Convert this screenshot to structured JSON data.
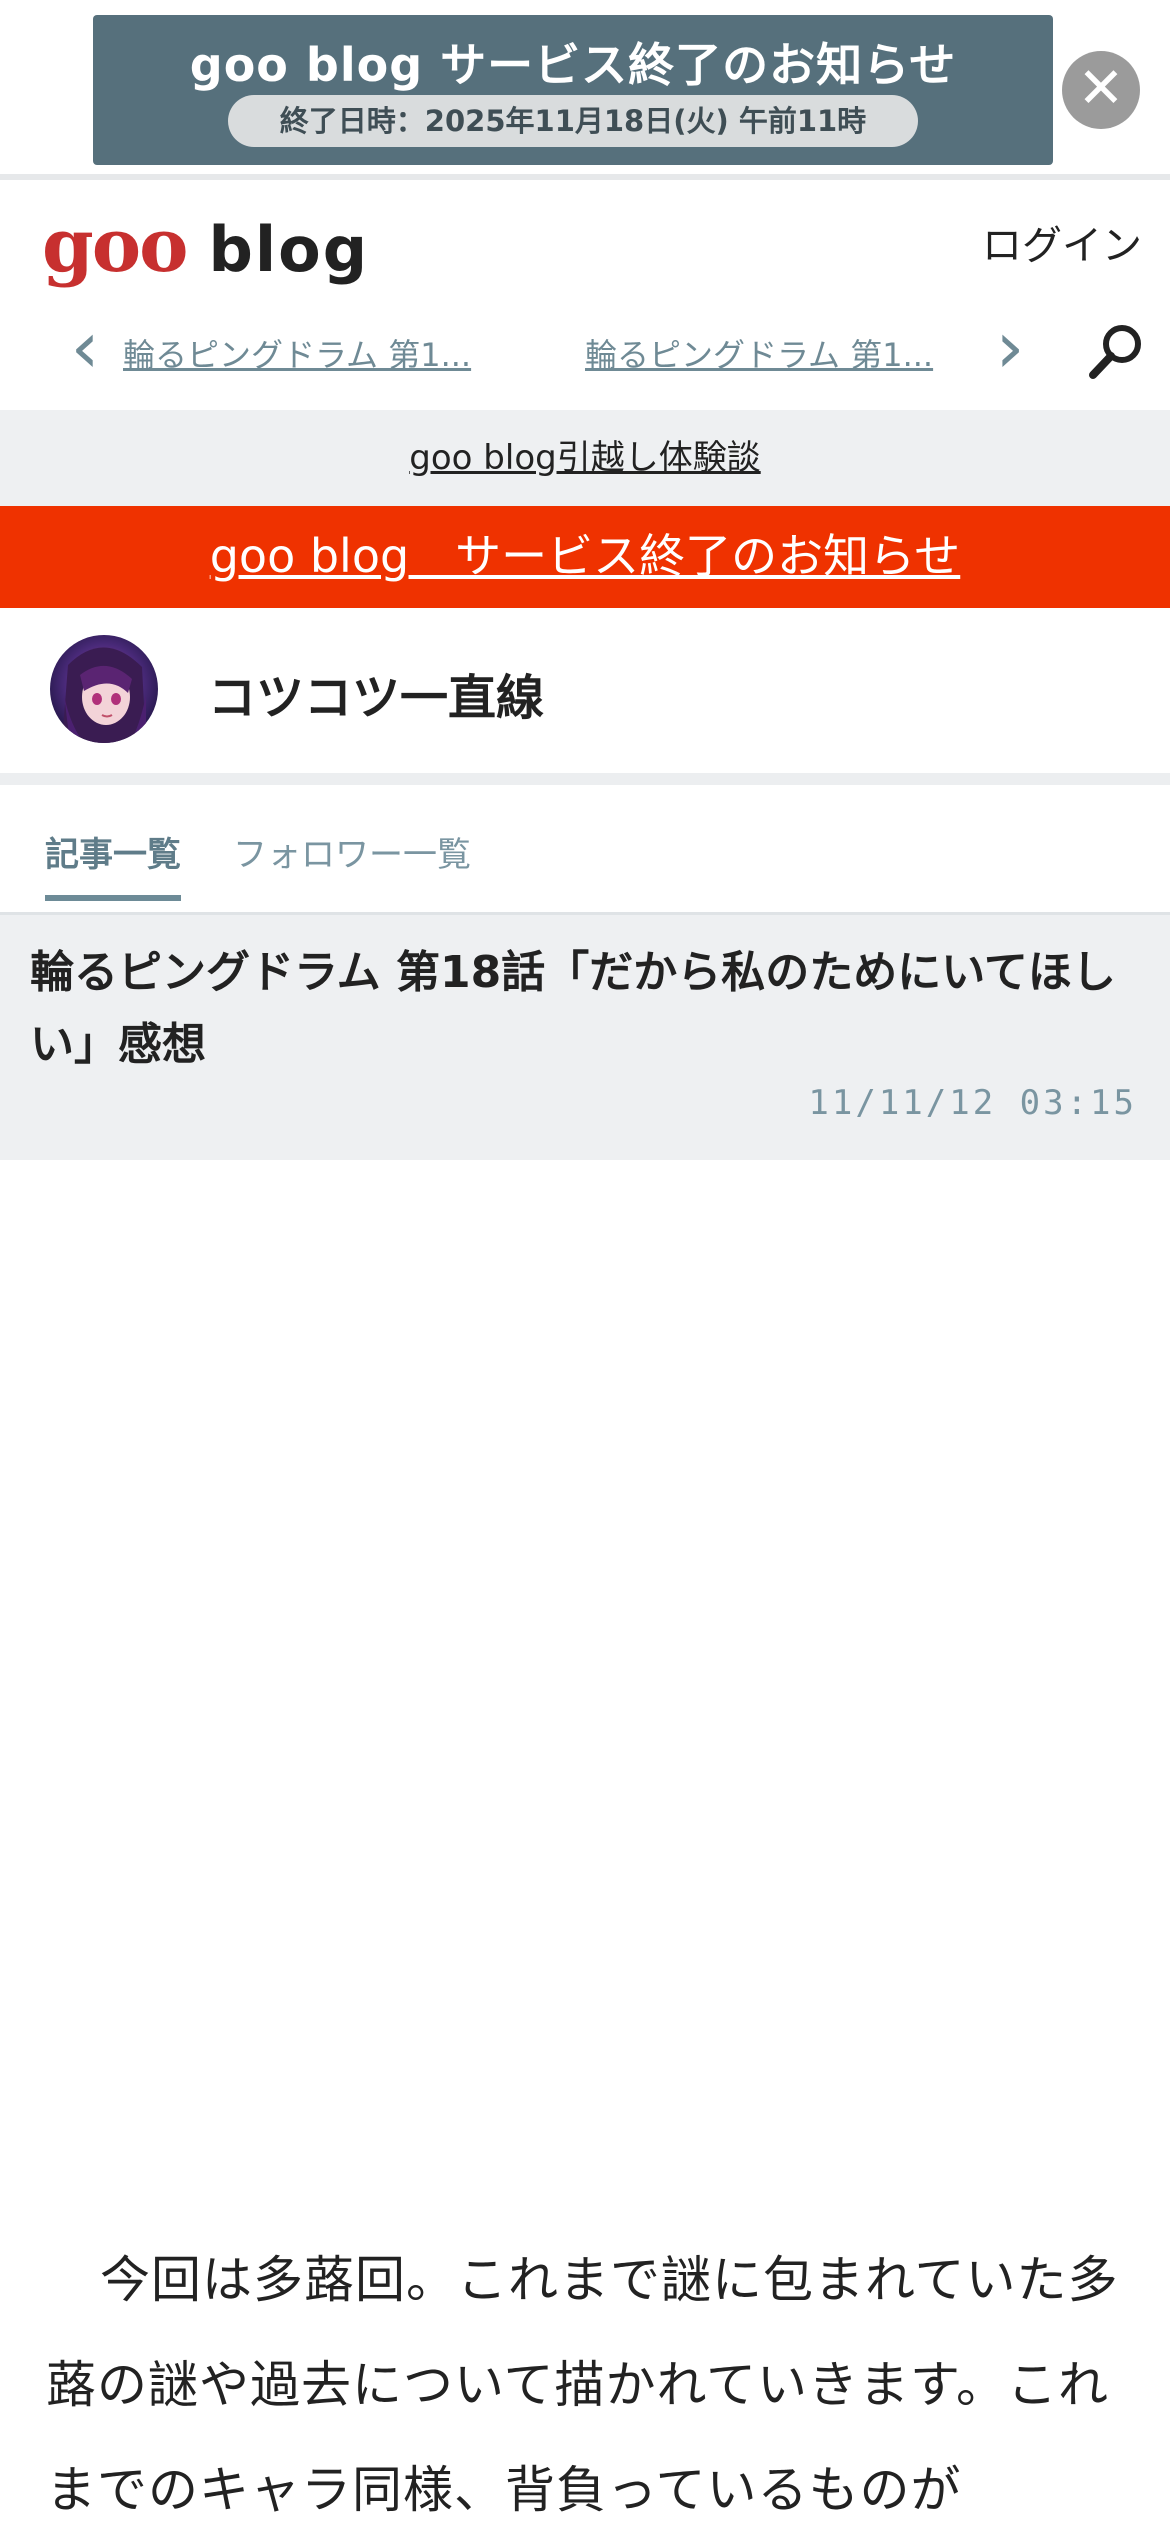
{
  "banner": {
    "title": "goo blog サービス終了のお知らせ",
    "subtitle": "終了日時：2025年11月18日(火) 午前11時",
    "close_symbol": "✕"
  },
  "header": {
    "logo_goo": "goo",
    "logo_blog": "blog",
    "login": "ログイン"
  },
  "nav": {
    "prev_label": "輪るピングドラム 第1...",
    "next_label": "輪るピングドラム 第1...",
    "prev_symbol": "‹",
    "next_symbol": "›"
  },
  "notice_link": "goo blog引越し体験談",
  "end_notice": "goo blog　サービス終了のお知らせ",
  "profile": {
    "name": "コツコツ一直線"
  },
  "tabs": [
    {
      "label": "記事一覧",
      "active": true
    },
    {
      "label": "フォロワー一覧",
      "active": false
    }
  ],
  "article": {
    "title": "輪るピングドラム 第18話「だから私のためにいてほしい」感想",
    "date": "11/11/12 03:15",
    "body": "今回は多蕗回。これまで謎に包まれていた多蕗の謎や過去について描かれていきます。これまでのキャラ同様、背負っているものが"
  },
  "colors": {
    "accent_red": "#ef3200",
    "banner_bg": "#56707c",
    "muted_blue": "#7a95a1",
    "logo_red": "#c7302f"
  }
}
